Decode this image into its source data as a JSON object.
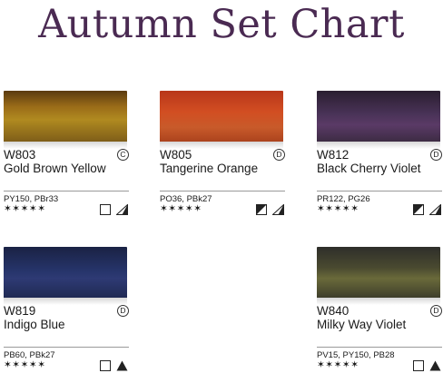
{
  "title": "Autumn Set Chart",
  "cards": [
    {
      "code": "W803",
      "name": "Gold Brown Yellow",
      "badge": "C",
      "pigments": "PY150, PBr33",
      "stars": "✶✶✶✶✶",
      "swatch_color": "#8a5c14",
      "icons": [
        "transparent",
        "semi-transparent"
      ]
    },
    {
      "code": "W805",
      "name": "Tangerine Orange",
      "badge": "D",
      "pigments": "PO36, PBk27",
      "stars": "✶✶✶✶✶",
      "swatch_color": "#c4451f",
      "icons": [
        "semi-opaque",
        "semi-transparent"
      ]
    },
    {
      "code": "W812",
      "name": "Black Cherry Violet",
      "badge": "D",
      "pigments": "PR122, PG26",
      "stars": "✶✶✶✶✶",
      "swatch_color": "#3f2a47",
      "icons": [
        "semi-opaque",
        "semi-transparent"
      ]
    },
    {
      "code": "W819",
      "name": "Indigo Blue",
      "badge": "D",
      "pigments": "PB60, PBk27",
      "stars": "✶✶✶✶✶",
      "swatch_color": "#1e2a52",
      "icons": [
        "transparent",
        "opaque"
      ]
    },
    {
      "code": "W840",
      "name": "Milky Way Violet",
      "badge": "D",
      "pigments": "PV15, PY150, PB28",
      "stars": "✶✶✶✶✶",
      "swatch_color": "#4a4a30",
      "icons": [
        "transparent",
        "opaque"
      ]
    }
  ]
}
